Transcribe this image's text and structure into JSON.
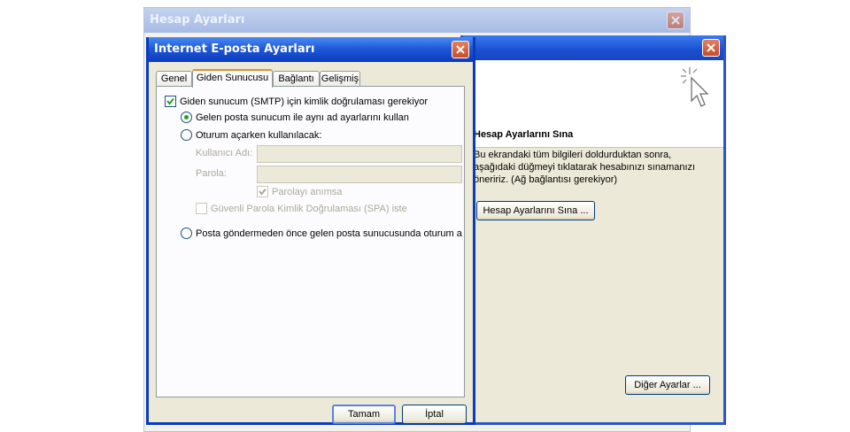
{
  "back_window": {
    "title": "Hesap Ayarları"
  },
  "middle_window": {
    "heading": "Hesap Ayarlarını Sına",
    "description": "Bu ekrandaki tüm bilgileri doldurduktan sonra, aşağıdaki düğmeyi tıklatarak hesabınızı sınamanızı öneririz. (Ağ bağlantısı gerekiyor)",
    "test_button": "Hesap Ayarlarını Sına ...",
    "more_settings_button": "Diğer Ayarlar ..."
  },
  "dialog": {
    "title": "Internet E-posta Ayarları",
    "tabs": [
      {
        "label": "Genel",
        "active": false
      },
      {
        "label": "Giden Sunucusu",
        "active": true
      },
      {
        "label": "Bağlantı",
        "active": false
      },
      {
        "label": "Gelişmiş",
        "active": false
      }
    ],
    "smtp_auth_checkbox": {
      "label": "Giden sunucum (SMTP) için kimlik doğrulaması gerekiyor",
      "checked": true
    },
    "radio_same_settings": {
      "label": "Gelen posta sunucum ile aynı ad ayarlarını kullan",
      "selected": true
    },
    "radio_login_with": {
      "label": "Oturum açarken kullanılacak:",
      "selected": false
    },
    "username": {
      "label": "Kullanıcı Adı:",
      "value": ""
    },
    "password": {
      "label": "Parola:",
      "value": ""
    },
    "remember_password": {
      "label": "Parolayı anımsa",
      "checked": true
    },
    "spa": {
      "label": "Güvenli Parola Kimlik Doğrulaması (SPA) iste",
      "checked": false
    },
    "radio_login_incoming_first": {
      "label": "Posta göndermeden önce gelen posta sunucusunda oturum aç",
      "selected": false
    },
    "ok_button": "Tamam",
    "cancel_button": "İptal"
  },
  "colors": {
    "titlebar_active": "#0a3bbd",
    "titlebar_inactive": "#a8bbe4",
    "close": "#c94d29",
    "tab_highlight": "#e68b2c",
    "check_mark": "#21a121"
  }
}
